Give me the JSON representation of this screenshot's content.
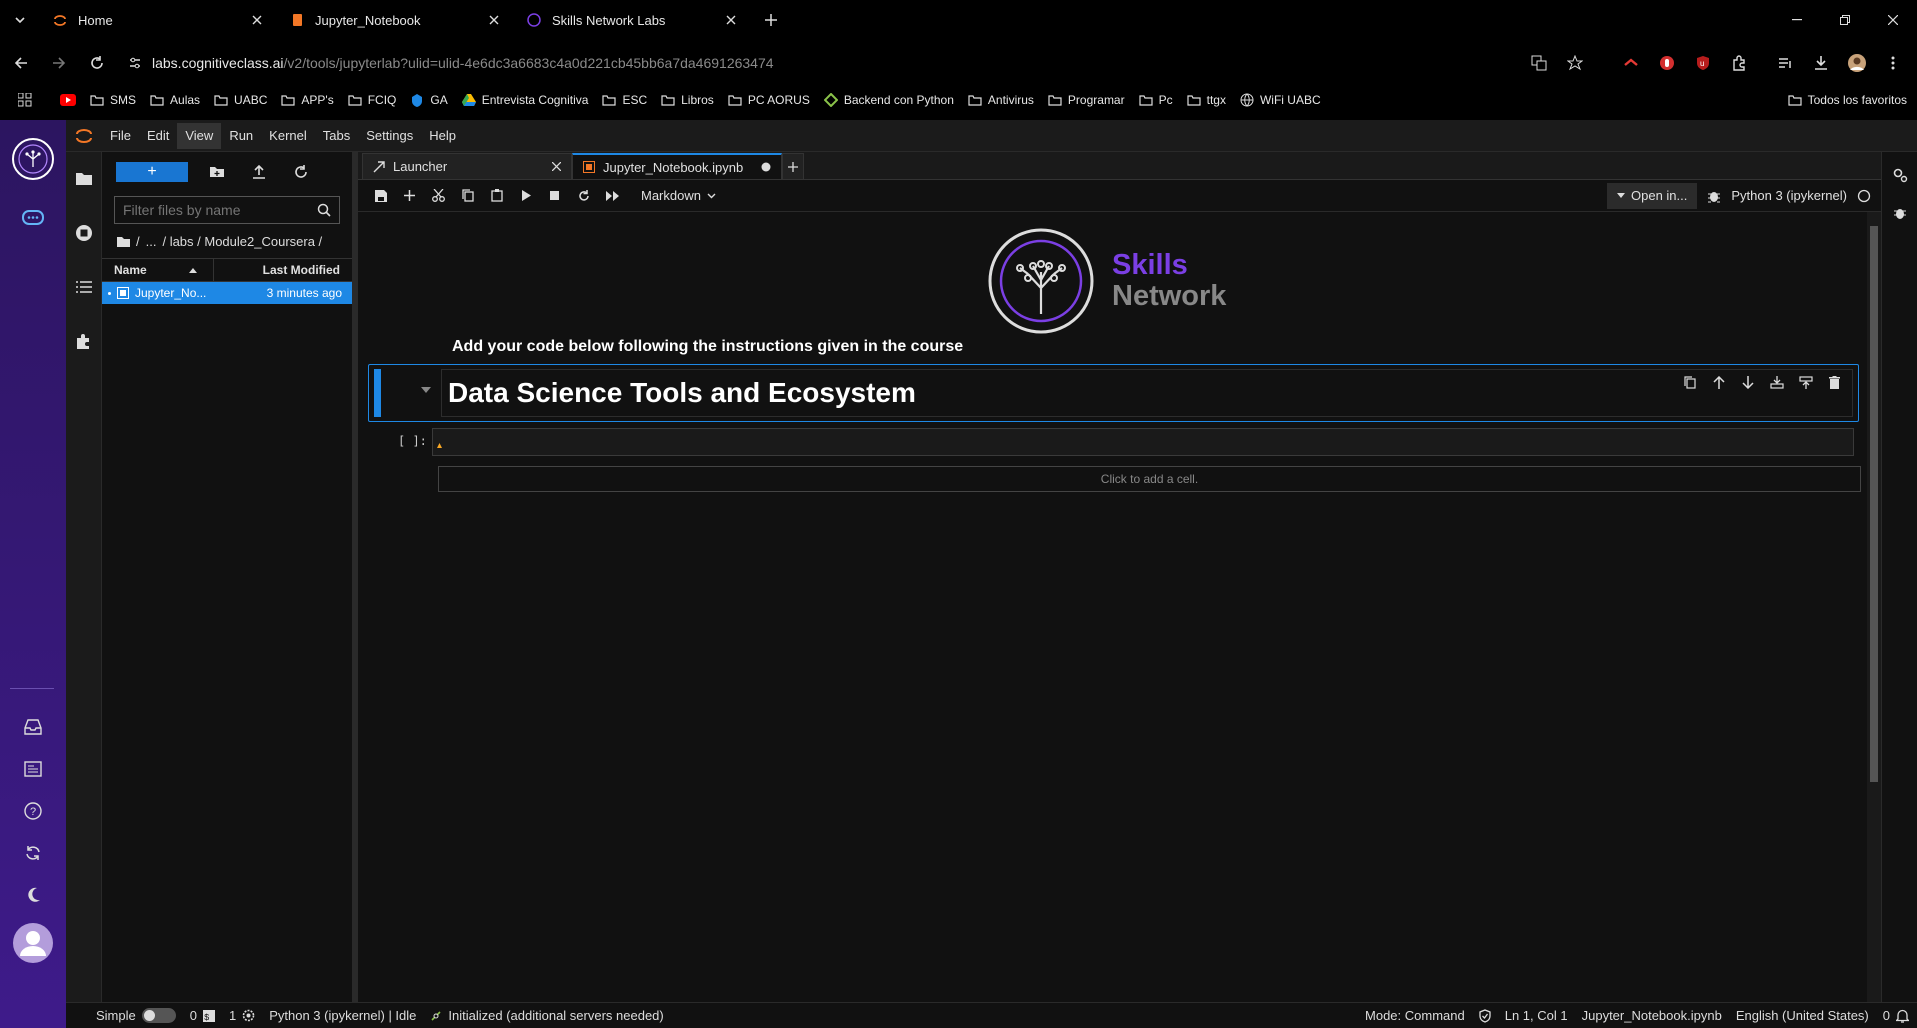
{
  "browser": {
    "tabs": [
      {
        "title": "Home",
        "active": false
      },
      {
        "title": "Jupyter_Notebook",
        "active": false
      },
      {
        "title": "Skills Network Labs",
        "active": true
      }
    ],
    "url_host": "labs.cognitiveclass.ai",
    "url_path": "/v2/tools/jupyterlab?ulid=ulid-4e6dc3a6683c4a0d221cb45bb6a7da4691263474",
    "bookmarks": [
      "SMS",
      "Aulas",
      "UABC",
      "APP's",
      "FCIQ",
      "GA",
      "Entrevista Cognitiva",
      "ESC",
      "Libros",
      "PC AORUS",
      "Backend con Python",
      "Antivirus",
      "Programar",
      "Pc",
      "ttgx",
      "WiFi UABC"
    ],
    "all_bookmarks": "Todos los favoritos"
  },
  "menu": [
    "File",
    "Edit",
    "View",
    "Run",
    "Kernel",
    "Tabs",
    "Settings",
    "Help"
  ],
  "menu_selected": "View",
  "filebrowser": {
    "new_label": "+",
    "filter_placeholder": "Filter files by name",
    "breadcrumb": [
      "/",
      "...",
      "/ labs / Module2_Coursera /"
    ],
    "col_name": "Name",
    "col_modified": "Last Modified",
    "files": [
      {
        "name": "Jupyter_No...",
        "modified": "3 minutes ago"
      }
    ]
  },
  "doc_tabs": [
    {
      "title": "Launcher"
    },
    {
      "title": "Jupyter_Notebook.ipynb"
    }
  ],
  "notebook_toolbar": {
    "cell_type": "Markdown",
    "open_in": "Open in...",
    "kernel": "Python 3 (ipykernel)"
  },
  "notebook": {
    "logo_line1": "Skills",
    "logo_line2": "Network",
    "instructions": "Add your code below following the instructions given in the course",
    "heading": "Data Science Tools and Ecosystem",
    "code_prompt": "[ ]:",
    "add_cell": "Click to add a cell."
  },
  "statusbar": {
    "simple": "Simple",
    "count0": "0",
    "count1": "1",
    "kernel_status": "Python 3 (ipykernel) | Idle",
    "init": "Initialized (additional servers needed)",
    "mode": "Mode: Command",
    "position": "Ln 1, Col 1",
    "filename": "Jupyter_Notebook.ipynb",
    "language": "English (United States)",
    "notifications": "0"
  },
  "colors": {
    "accent": "#1e88e5",
    "brand_purple": "#7b3fe4",
    "sidebar": "#3e1b8a"
  }
}
